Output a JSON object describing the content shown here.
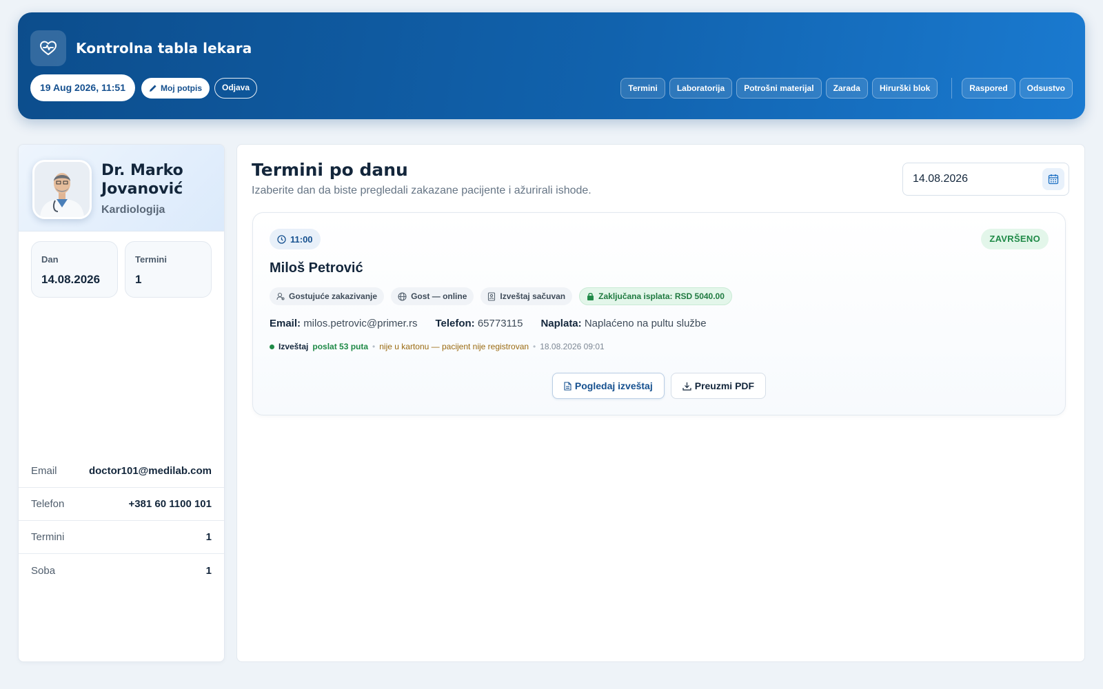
{
  "header": {
    "title": "Kontrolna tabla lekara",
    "datetime": "19 Aug 2026, 11:51",
    "signature_label": "Moj potpis",
    "logout_label": "Odjava",
    "nav": [
      {
        "label": "Termini"
      },
      {
        "label": "Laboratorija"
      },
      {
        "label": "Potrošni materijal"
      },
      {
        "label": "Zarada"
      },
      {
        "label": "Hirurški blok"
      }
    ],
    "nav_secondary": [
      {
        "label": "Raspored"
      },
      {
        "label": "Odsustvo"
      }
    ]
  },
  "doctor": {
    "name": "Dr. Marko Jovanović",
    "specialty": "Kardiologija",
    "stats": [
      {
        "label": "Dan",
        "value": "14.08.2026"
      },
      {
        "label": "Termini",
        "value": "1"
      }
    ],
    "info": [
      {
        "key": "Email",
        "value": "doctor101@medilab.com"
      },
      {
        "key": "Telefon",
        "value": "+381 60 1100 101"
      },
      {
        "key": "Termini",
        "value": "1"
      },
      {
        "key": "Soba",
        "value": "1"
      }
    ]
  },
  "main": {
    "title": "Termini po danu",
    "subtitle": "Izaberite dan da biste pregledali zakazane pacijente i ažurirali ishode.",
    "date_value": "14.08.2026",
    "appointment": {
      "time": "11:00",
      "status": "ZAVRŠENO",
      "patient": "Miloš Petrović",
      "tags": [
        {
          "label": "Gostujuće zakazivanje",
          "icon": "user-icon"
        },
        {
          "label": "Gost — online",
          "icon": "globe-icon"
        },
        {
          "label": "Izveštaj sačuvan",
          "icon": "document-icon"
        },
        {
          "label": "Zaključana isplata: RSD 5040.00",
          "icon": "lock-icon"
        }
      ],
      "email_label": "Email:",
      "email": "milos.petrovic@primer.rs",
      "phone_label": "Telefon:",
      "phone": "65773115",
      "payment_label": "Naplata:",
      "payment": "Naplaćeno na pultu službe",
      "report": {
        "label": "Izveštaj",
        "sent": "poslat 53 puta",
        "warning": "nije u kartonu — pacijent nije registrovan",
        "timestamp": "18.08.2026 09:01"
      },
      "view_label": "Pogledaj izveštaj",
      "download_label": "Preuzmi PDF"
    }
  },
  "colors": {
    "header_gradient_start": "#0c4d8c",
    "header_gradient_end": "#1a7ad0",
    "success": "#1f8a47",
    "warning": "#9a6a10",
    "primary_text": "#15508f"
  }
}
